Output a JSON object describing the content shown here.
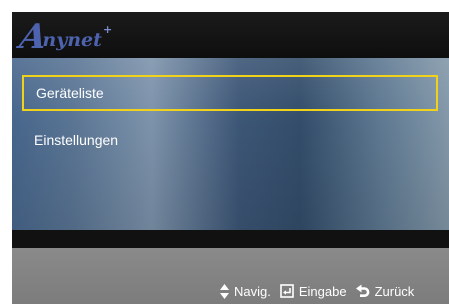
{
  "logo": {
    "big_letter": "A",
    "rest": "nynet",
    "plus": "+"
  },
  "menu": {
    "items": [
      {
        "label": "Geräteliste",
        "selected": true
      },
      {
        "label": "Einstellungen",
        "selected": false
      }
    ]
  },
  "footer": {
    "hints": [
      {
        "icon": "up-down-arrows-icon",
        "label": "Navig."
      },
      {
        "icon": "enter-icon",
        "label": "Eingabe"
      },
      {
        "icon": "return-icon",
        "label": "Zurück"
      }
    ]
  },
  "colors": {
    "highlight": "#f1d21a",
    "logo": "#4d63ae",
    "footer": "#858585"
  }
}
